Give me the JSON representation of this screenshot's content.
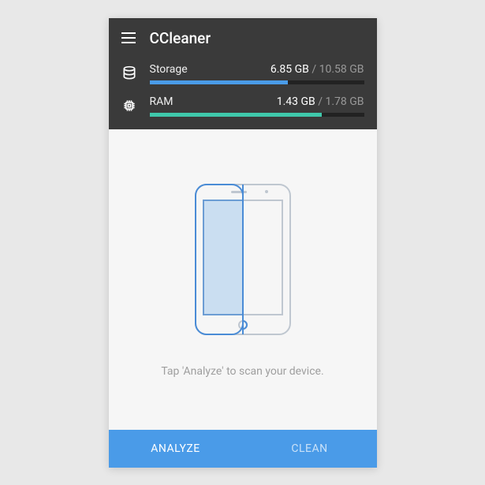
{
  "header": {
    "title": "CCleaner"
  },
  "metrics": {
    "storage": {
      "label": "Storage",
      "used": "6.85 GB",
      "total": "10.58 GB"
    },
    "ram": {
      "label": "RAM",
      "used": "1.43 GB",
      "total": "1.78 GB"
    }
  },
  "content": {
    "hint": "Tap 'Analyze' to scan your device."
  },
  "footer": {
    "analyze": "ANALYZE",
    "clean": "CLEAN"
  }
}
